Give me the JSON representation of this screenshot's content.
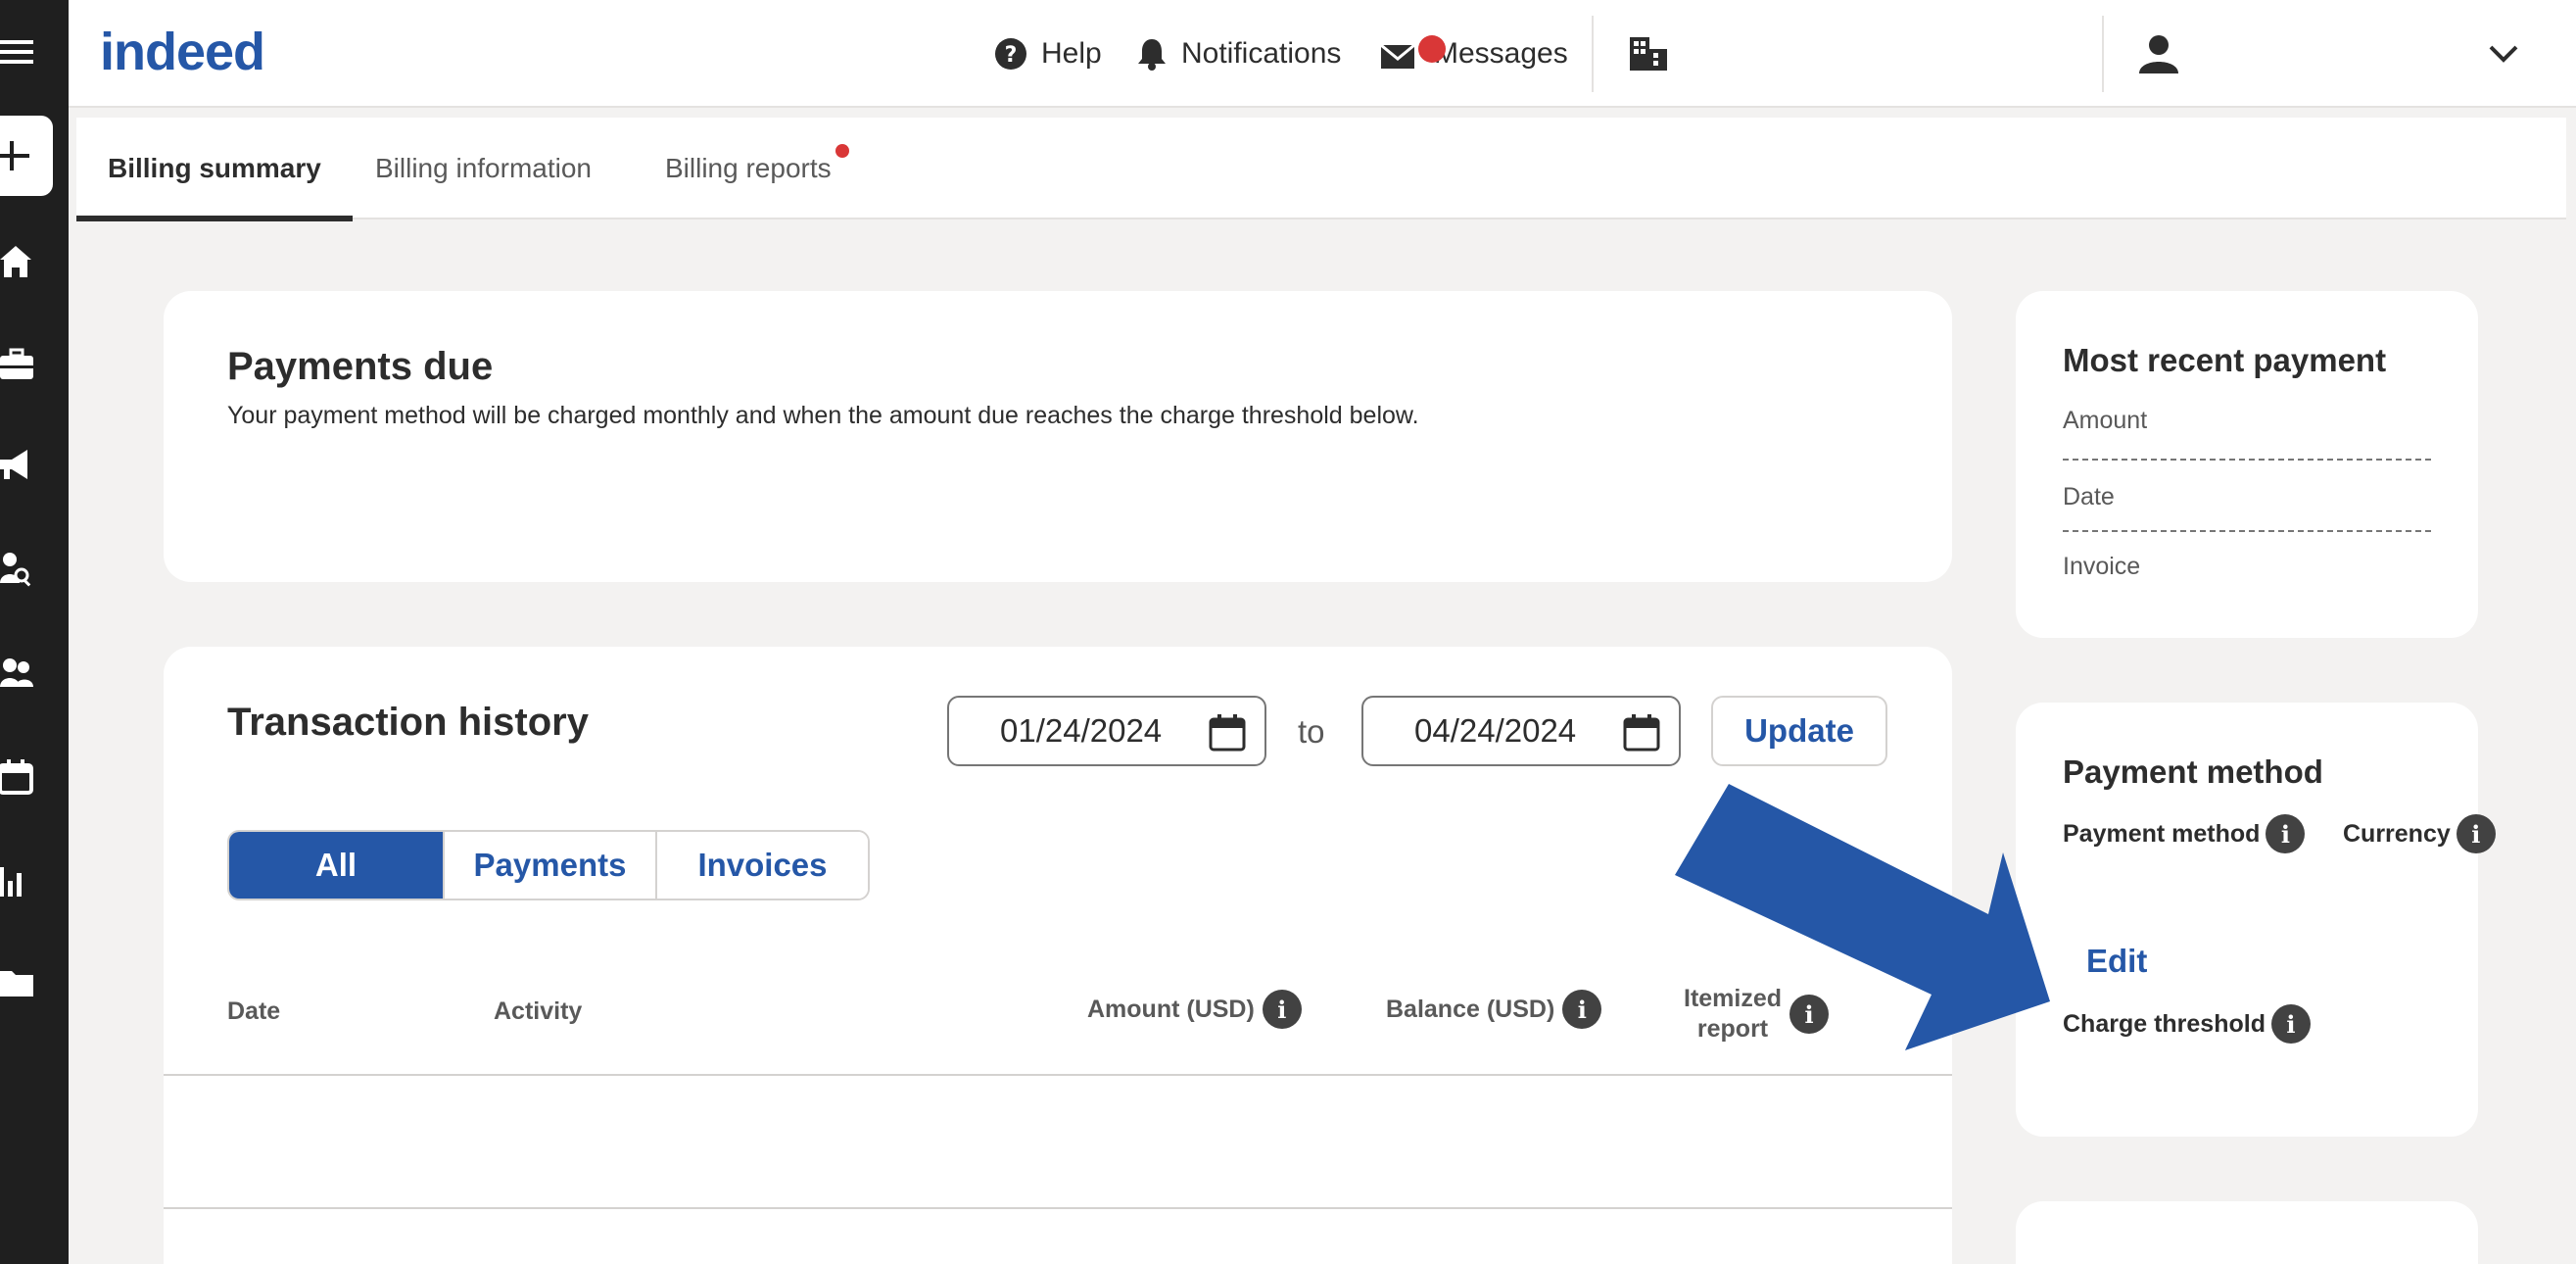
{
  "brand": {
    "logo_text": "indeed",
    "accent": "#2557a7",
    "alert": "#d93737"
  },
  "left_rail": {
    "items": [
      {
        "name": "menu-icon"
      },
      {
        "name": "create-plus-icon"
      },
      {
        "name": "home-icon"
      },
      {
        "name": "jobs-briefcase-icon"
      },
      {
        "name": "campaigns-megaphone-icon"
      },
      {
        "name": "candidate-search-icon"
      },
      {
        "name": "candidates-people-icon"
      },
      {
        "name": "calendar-icon"
      },
      {
        "name": "analytics-bar-icon"
      },
      {
        "name": "folder-icon"
      }
    ]
  },
  "header": {
    "help_label": "Help",
    "notifications_label": "Notifications",
    "messages_label": "Messages"
  },
  "tabs": [
    {
      "label": "Billing summary",
      "active": true
    },
    {
      "label": "Billing information",
      "active": false
    },
    {
      "label": "Billing reports",
      "active": false,
      "dot": true
    }
  ],
  "payments_due": {
    "title": "Payments due",
    "description": "Your payment method will be charged monthly and when the amount due reaches the charge threshold below."
  },
  "transaction_history": {
    "title": "Transaction history",
    "start_date": "01/24/2024",
    "to_label": "to",
    "end_date": "04/24/2024",
    "update_label": "Update",
    "filters": [
      {
        "label": "All",
        "active": true
      },
      {
        "label": "Payments",
        "active": false
      },
      {
        "label": "Invoices",
        "active": false
      }
    ],
    "columns": {
      "date": "Date",
      "activity": "Activity",
      "amount": "Amount (USD)",
      "balance": "Balance (USD)",
      "itemized_line1": "Itemized",
      "itemized_line2": "report"
    }
  },
  "most_recent_payment": {
    "title": "Most recent payment",
    "amount_label": "Amount",
    "date_label": "Date",
    "invoice_label": "Invoice"
  },
  "payment_method": {
    "title": "Payment method",
    "method_label": "Payment method",
    "currency_label": "Currency",
    "edit_label": "Edit",
    "threshold_label": "Charge threshold"
  }
}
